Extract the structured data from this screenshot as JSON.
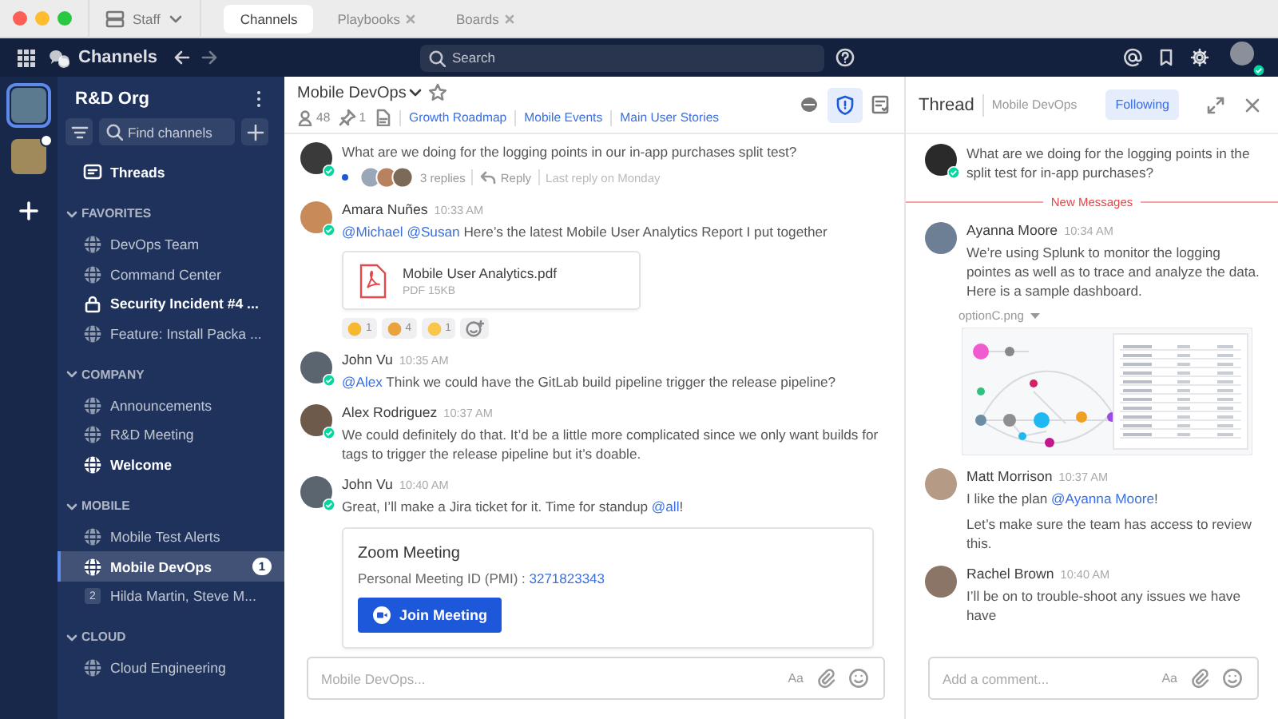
{
  "os_bar": {
    "workspace": "Staff",
    "tabs": [
      {
        "label": "Channels",
        "selected": true,
        "closable": false
      },
      {
        "label": "Playbooks",
        "selected": false,
        "closable": true
      },
      {
        "label": "Boards",
        "selected": false,
        "closable": true
      }
    ]
  },
  "header": {
    "product": "Channels",
    "search": {
      "placeholder": "Search"
    }
  },
  "teams": [
    {
      "selected": true,
      "unread": false
    },
    {
      "selected": false,
      "unread": true
    }
  ],
  "sidebar": {
    "team_name": "R&D Org",
    "find": {
      "placeholder": "Find channels"
    },
    "threads": "Threads",
    "categories": [
      {
        "name": "FAVORITES",
        "expanded": true,
        "channels": [
          {
            "name": "DevOps Team",
            "kind": "public",
            "unread": false,
            "selected": false
          },
          {
            "name": "Command Center",
            "kind": "public",
            "unread": false,
            "selected": false
          },
          {
            "name": "Security Incident #4 ...",
            "kind": "private",
            "unread": true,
            "selected": false
          },
          {
            "name": "Feature: Install Packa ...",
            "kind": "public",
            "unread": false,
            "selected": false
          }
        ]
      },
      {
        "name": "COMPANY",
        "expanded": true,
        "channels": [
          {
            "name": "Announcements",
            "kind": "public",
            "unread": false,
            "selected": false
          },
          {
            "name": "R&D Meeting",
            "kind": "public",
            "unread": false,
            "selected": false
          },
          {
            "name": "Welcome",
            "kind": "public",
            "unread": true,
            "selected": false
          }
        ]
      },
      {
        "name": "MOBILE",
        "expanded": true,
        "channels": [
          {
            "name": "Mobile Test Alerts",
            "kind": "public",
            "unread": false,
            "selected": false
          },
          {
            "name": "Mobile DevOps",
            "kind": "public",
            "unread": true,
            "selected": true,
            "badge": "1"
          },
          {
            "name": "Hilda Martin, Steve M...",
            "kind": "group",
            "icon_text": "2",
            "unread": false,
            "selected": false
          }
        ]
      },
      {
        "name": "CLOUD",
        "expanded": true,
        "channels": [
          {
            "name": "Cloud Engineering",
            "kind": "public",
            "unread": false,
            "selected": false
          }
        ]
      }
    ]
  },
  "channel": {
    "name": "Mobile DevOps",
    "members": "48",
    "pinned": "1",
    "bookmarks": [
      "Growth Roadmap",
      "Mobile Events",
      "Main User Stories"
    ],
    "posts": [
      {
        "kind": "continuation",
        "online": true,
        "parts": [
          {
            "text": "What are we doing for the logging points in our in-app purchases split test?",
            "kind": "plain"
          }
        ],
        "thread": {
          "unread": true,
          "replies": "3 replies",
          "reply": "Reply",
          "last_reply": "Last reply on Monday"
        }
      },
      {
        "kind": "post",
        "author": "Amara Nuñes",
        "time": "10:33 AM",
        "online": true,
        "parts": [
          {
            "text": "@Michael @Susan",
            "kind": "mention"
          },
          {
            "text": " Here’s the latest Mobile User Analytics Report I put together",
            "kind": "plain"
          }
        ],
        "attachment": {
          "name": "Mobile User Analytics.pdf",
          "meta": "PDF 15KB"
        },
        "reactions": [
          {
            "count": "1",
            "color": "#f5b82e"
          },
          {
            "count": "4",
            "color": "#e8a33c"
          },
          {
            "count": "1",
            "color": "#f7c64a"
          }
        ]
      },
      {
        "kind": "post",
        "author": "John Vu",
        "time": "10:35 AM",
        "online": true,
        "parts": [
          {
            "text": "@Alex",
            "kind": "mention"
          },
          {
            "text": " Think we could have the GitLab build pipeline trigger the release pipeline?",
            "kind": "plain"
          }
        ]
      },
      {
        "kind": "post",
        "author": "Alex Rodriguez",
        "time": "10:37 AM",
        "online": true,
        "parts": [
          {
            "text": "We could definitely do that. It’d be a little more complicated since we only want builds for tags to trigger the release pipeline but it’s doable.",
            "kind": "plain"
          }
        ]
      },
      {
        "kind": "post",
        "author": "John Vu",
        "time": "10:40 AM",
        "online": true,
        "parts": [
          {
            "text": "Great, I’ll make a Jira ticket for it. Time for standup ",
            "kind": "plain"
          },
          {
            "text": "@all",
            "kind": "mention"
          },
          {
            "text": "!",
            "kind": "plain"
          }
        ],
        "card": {
          "title": "Zoom Meeting",
          "parts": [
            {
              "text": "Personal Meeting ID (PMI) : ",
              "kind": "plain"
            },
            {
              "text": "3271823343",
              "kind": "mention"
            }
          ],
          "button": "Join Meeting"
        }
      }
    ],
    "input": {
      "placeholder": "Mobile DevOps...",
      "format": "Aa"
    }
  },
  "thread": {
    "title": "Thread",
    "channel": "Mobile DevOps",
    "follow": {
      "label": "Following",
      "following": true
    },
    "root": {
      "online": true,
      "parts": [
        {
          "text": "What are we doing for the logging points in the split test for in-app purchases?",
          "kind": "plain"
        }
      ]
    },
    "divider": "New Messages",
    "replies": [
      {
        "author": "Ayanna Moore",
        "time": "10:34 AM",
        "online": false,
        "paragraphs": [
          [
            {
              "text": "We’re using Splunk to monitor the logging pointes as well as to trace and analyze the data. Here is a sample dashboard.",
              "kind": "plain"
            }
          ]
        ],
        "image": {
          "name": "optionC.png"
        }
      },
      {
        "author": "Matt Morrison",
        "time": "10:37 AM",
        "online": false,
        "paragraphs": [
          [
            {
              "text": "I like the plan ",
              "kind": "plain"
            },
            {
              "text": "@Ayanna Moore",
              "kind": "mention"
            },
            {
              "text": "!",
              "kind": "plain"
            }
          ],
          [
            {
              "text": "Let’s make sure the team has access to review this.",
              "kind": "plain"
            }
          ]
        ]
      },
      {
        "author": "Rachel Brown",
        "time": "10:40 AM",
        "online": false,
        "paragraphs": [
          [
            {
              "text": "I’ll be on to trouble-shoot any issues we have have",
              "kind": "plain"
            }
          ]
        ]
      }
    ],
    "input": {
      "placeholder": "Add a comment...",
      "format": "Aa"
    }
  }
}
